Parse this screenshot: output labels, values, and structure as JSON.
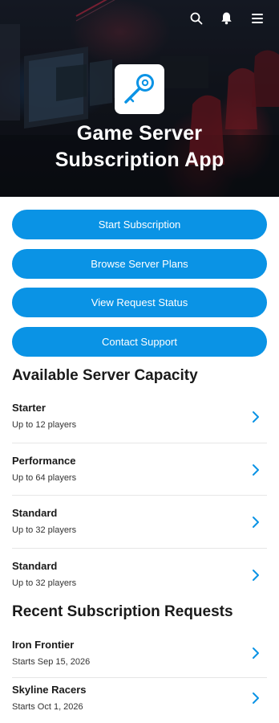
{
  "header": {
    "title": "Game Server Subscription App",
    "title_line1": "Game Server",
    "title_line2": "Subscription App",
    "icons": [
      "search-icon",
      "notification-bell-icon",
      "menu-icon"
    ],
    "logo_icon": "magnifier-key-icon"
  },
  "actions": [
    {
      "label": "Start Subscription"
    },
    {
      "label": "Browse Server Plans"
    },
    {
      "label": "View Request Status"
    },
    {
      "label": "Contact Support"
    }
  ],
  "capacity": {
    "heading": "Available Server Capacity",
    "items": [
      {
        "title": "Starter",
        "subtitle": "Up to 12 players"
      },
      {
        "title": "Performance",
        "subtitle": "Up to 64 players"
      },
      {
        "title": "Standard",
        "subtitle": "Up to 32 players"
      },
      {
        "title": "Standard",
        "subtitle": "Up to 32 players"
      }
    ]
  },
  "requests": {
    "heading": "Recent Subscription Requests",
    "items": [
      {
        "title": "Iron Frontier",
        "subtitle": "Starts Sep 15, 2026"
      },
      {
        "title": "Skyline Racers",
        "subtitle": "Starts Oct 1, 2026"
      }
    ]
  },
  "colors": {
    "accent": "#0a93e5",
    "divider": "#e6e6e6",
    "hero_text": "#ffffff"
  }
}
